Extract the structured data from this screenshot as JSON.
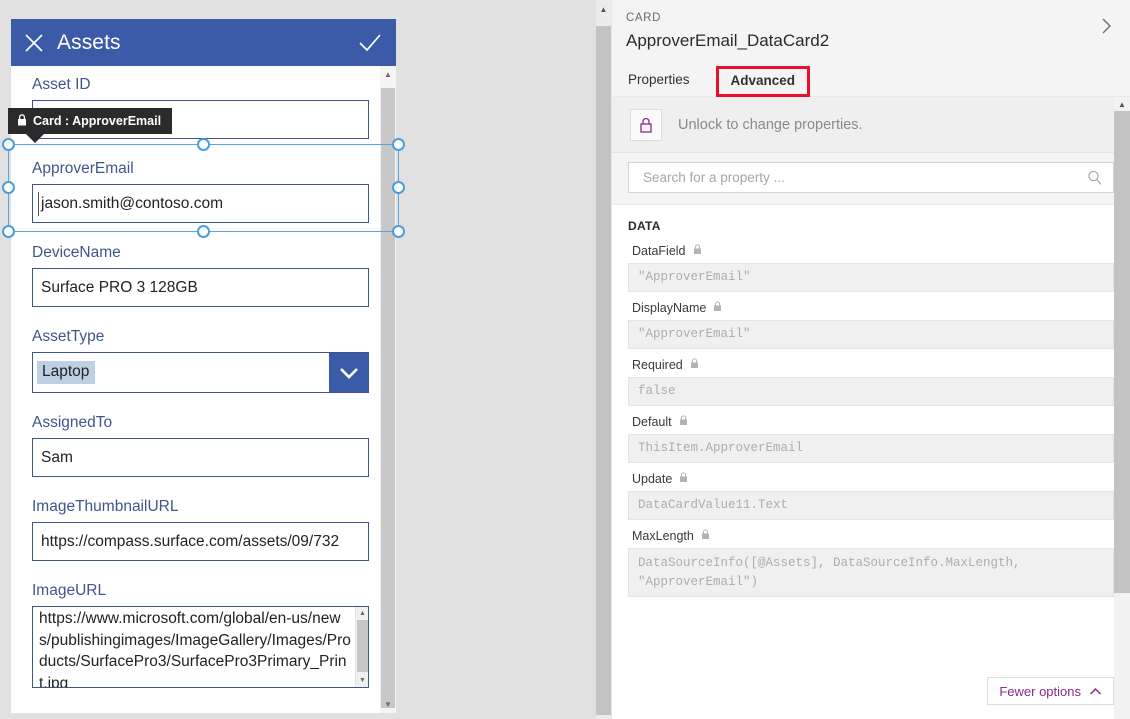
{
  "app": {
    "header": {
      "title": "Assets",
      "close_icon": "close-icon",
      "confirm_icon": "checkmark-icon"
    }
  },
  "tooltip": {
    "text": "Card : ApproverEmail",
    "icon": "lock-icon"
  },
  "form": {
    "fields": [
      {
        "label": "Asset ID",
        "value": "",
        "type": "text"
      },
      {
        "label": "ApproverEmail",
        "value": "jason.smith@contoso.com",
        "type": "text"
      },
      {
        "label": "DeviceName",
        "value": "Surface PRO 3 128GB",
        "type": "text"
      },
      {
        "label": "AssetType",
        "value": "Laptop",
        "type": "dropdown"
      },
      {
        "label": "AssignedTo",
        "value": "Sam",
        "type": "text"
      },
      {
        "label": "ImageThumbnailURL",
        "value": "https://compass.surface.com/assets/09/732",
        "type": "text"
      },
      {
        "label": "ImageURL",
        "value": "https://www.microsoft.com/global/en-us/news/publishingimages/ImageGallery/Images/Products/SurfacePro3/SurfacePro3Primary_Print.jpg",
        "type": "textarea"
      }
    ]
  },
  "panel": {
    "kicker": "CARD",
    "control_name": "ApproverEmail_DataCard2",
    "expand_icon": "chevron-right-icon",
    "tabs": [
      {
        "label": "Properties",
        "active": false
      },
      {
        "label": "Advanced",
        "active": true
      }
    ],
    "lockbar": {
      "icon": "lock-icon",
      "text": "Unlock to change properties."
    },
    "search": {
      "placeholder": "Search for a property ...",
      "value": "",
      "icon": "search-icon"
    },
    "section_title": "DATA",
    "properties": [
      {
        "name": "DataField",
        "value": "\"ApproverEmail\"",
        "locked": true
      },
      {
        "name": "DisplayName",
        "value": "\"ApproverEmail\"",
        "locked": true
      },
      {
        "name": "Required",
        "value": "false",
        "locked": true
      },
      {
        "name": "Default",
        "value": "ThisItem.ApproverEmail",
        "locked": true
      },
      {
        "name": "Update",
        "value": "DataCardValue11.Text",
        "locked": true
      },
      {
        "name": "MaxLength",
        "value": "DataSourceInfo([@Assets], DataSourceInfo.MaxLength, \"ApproverEmail\")",
        "locked": true
      }
    ],
    "fewer_options": {
      "label": "Fewer options",
      "icon": "chevron-up-icon"
    }
  },
  "colors": {
    "app_header": "#3b5aa8",
    "field_label": "#41558d",
    "highlight_red": "#e8112d",
    "accent_purple": "#8a2a8a",
    "selection_blue": "#4a9ddd"
  }
}
